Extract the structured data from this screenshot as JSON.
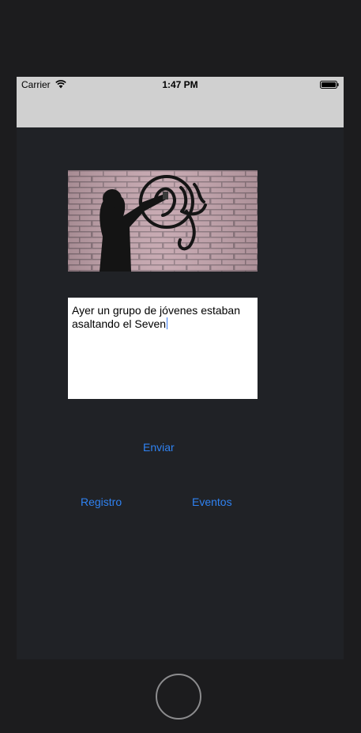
{
  "status_bar": {
    "carrier": "Carrier",
    "time": "1:47 PM",
    "wifi_icon": "wifi-icon",
    "battery_icon": "battery-icon"
  },
  "photo": {
    "subject": "person spray-painting graffiti on a pink brick wall"
  },
  "report": {
    "text": "Ayer un grupo de jóvenes estaban asaltando el Seven"
  },
  "buttons": {
    "send": "Enviar",
    "register": "Registro",
    "events": "Eventos"
  },
  "colors": {
    "screen_background": "#202226",
    "bars": "#d0d0d0",
    "link": "#2f82f1",
    "bezel": "#1c1c1e"
  }
}
